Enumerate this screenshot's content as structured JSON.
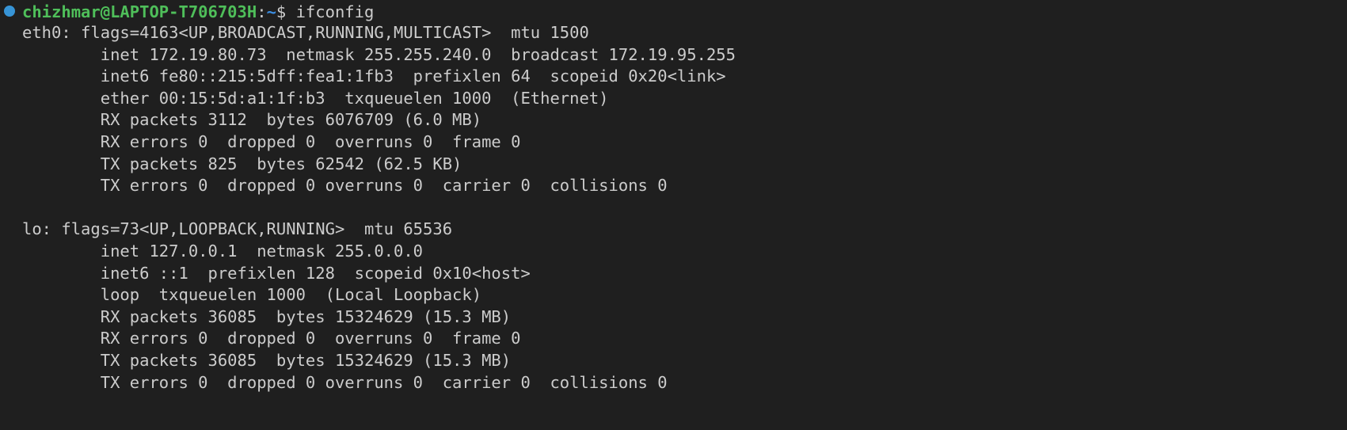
{
  "prompt": {
    "user_host": "chizhmar@LAPTOP-T706703H",
    "colon": ":",
    "path": "~",
    "symbol": "$",
    "command": " ifconfig"
  },
  "output_lines": [
    "eth0: flags=4163<UP,BROADCAST,RUNNING,MULTICAST>  mtu 1500",
    "        inet 172.19.80.73  netmask 255.255.240.0  broadcast 172.19.95.255",
    "        inet6 fe80::215:5dff:fea1:1fb3  prefixlen 64  scopeid 0x20<link>",
    "        ether 00:15:5d:a1:1f:b3  txqueuelen 1000  (Ethernet)",
    "        RX packets 3112  bytes 6076709 (6.0 MB)",
    "        RX errors 0  dropped 0  overruns 0  frame 0",
    "        TX packets 825  bytes 62542 (62.5 KB)",
    "        TX errors 0  dropped 0 overruns 0  carrier 0  collisions 0",
    "",
    "lo: flags=73<UP,LOOPBACK,RUNNING>  mtu 65536",
    "        inet 127.0.0.1  netmask 255.0.0.0",
    "        inet6 ::1  prefixlen 128  scopeid 0x10<host>",
    "        loop  txqueuelen 1000  (Local Loopback)",
    "        RX packets 36085  bytes 15324629 (15.3 MB)",
    "        RX errors 0  dropped 0  overruns 0  frame 0",
    "        TX packets 36085  bytes 15324629 (15.3 MB)",
    "        TX errors 0  dropped 0 overruns 0  carrier 0  collisions 0"
  ],
  "colors": {
    "background": "#1f1f1f",
    "text": "#cccccc",
    "user_host": "#4fbf5a",
    "path": "#3b8ee3",
    "status_dot": "#3794d6"
  }
}
